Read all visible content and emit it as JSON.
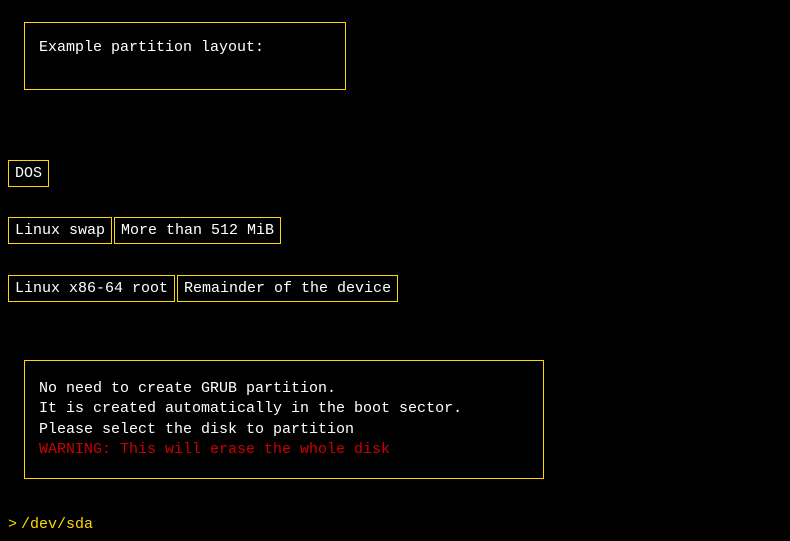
{
  "header": {
    "title": "Example partition layout:"
  },
  "partition_table": {
    "type": "DOS"
  },
  "partitions": [
    {
      "type": "Linux swap",
      "size": "More than 512 MiB"
    },
    {
      "type": "Linux x86-64 root",
      "size": "Remainder of the device"
    }
  ],
  "info": {
    "line1": "No need to create GRUB partition.",
    "line2": "It is created automatically in the boot sector.",
    "line3": "Please select the disk to partition",
    "warning": "WARNING: This will erase the whole disk"
  },
  "prompt": {
    "symbol": ">",
    "value": "/dev/sda"
  }
}
